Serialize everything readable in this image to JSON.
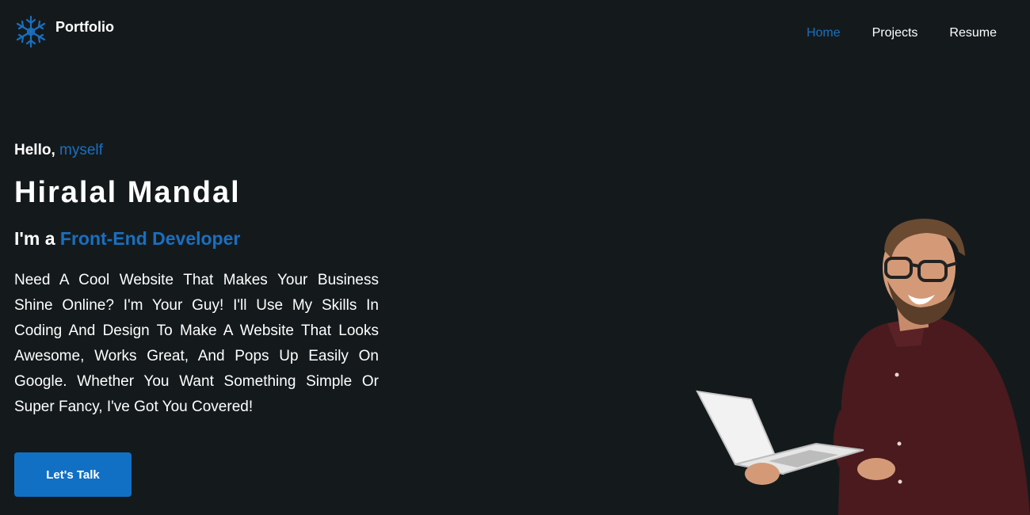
{
  "brand": {
    "name": "Portfolio",
    "logo_icon": "snowflake-icon",
    "accent_color": "#1b6fbf"
  },
  "nav": {
    "items": [
      {
        "label": "Home",
        "active": true
      },
      {
        "label": "Projects",
        "active": false
      },
      {
        "label": "Resume",
        "active": false
      }
    ]
  },
  "hero": {
    "greeting": "Hello,",
    "greeting_accent": "myself",
    "name": "Hiralal Mandal",
    "role_prefix": "I'm a",
    "role_accent": "Front-End Developer",
    "description": "Need A Cool Website That Makes Your Business Shine Online? I'm Your Guy! I'll Use My Skills In Coding And Design To Make A Website That Looks Awesome, Works Great, And Pops Up Easily On Google. Whether You Want Something Simple Or Super Fancy, I've Got You Covered!",
    "cta_label": "Let's Talk"
  },
  "colors": {
    "background": "#141a1c",
    "accent": "#1b6fbf",
    "button": "#1270c4",
    "text": "#ffffff"
  }
}
